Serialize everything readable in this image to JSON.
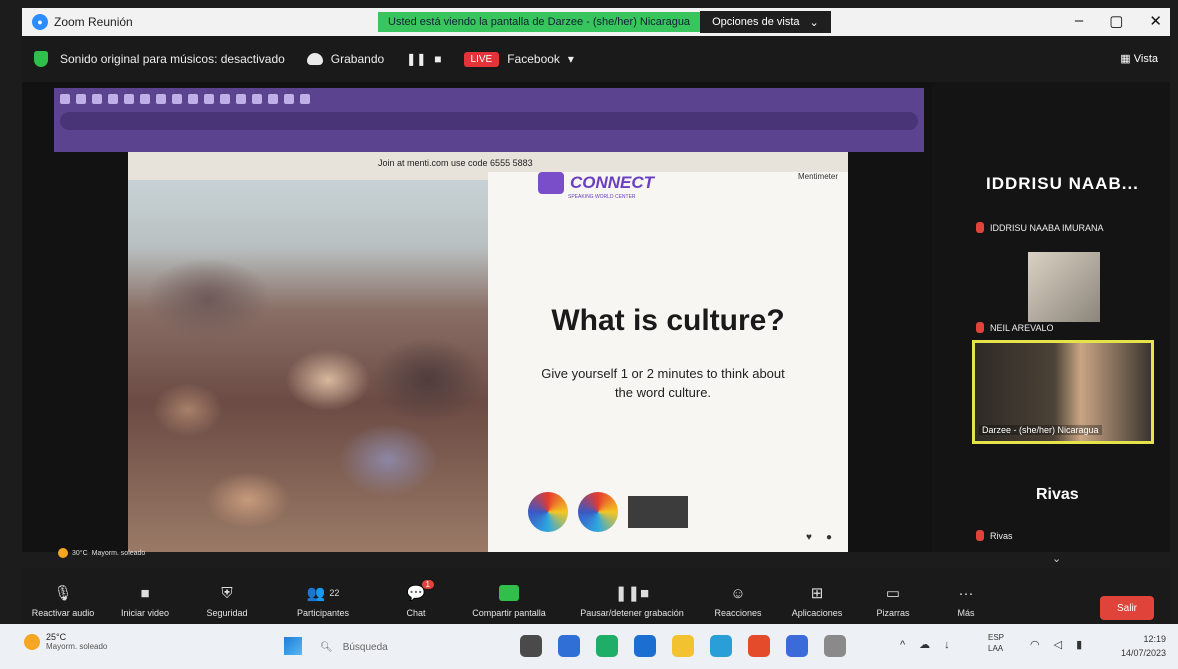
{
  "window": {
    "title": "Zoom Reunión",
    "share_banner": "Usted está viendo la pantalla de Darzee - (she/her) Nicaragua",
    "view_options": "Opciones de vista"
  },
  "meeting_bar": {
    "original_sound": "Sonido original para músicos: desactivado",
    "recording": "Grabando",
    "live": "LIVE",
    "facebook": "Facebook",
    "view": "Vista"
  },
  "slide": {
    "join_text": "Join at menti.com use code 6555 5883",
    "brand": "CONNECT",
    "brand_sub": "SPEAKING WORLD CENTER",
    "mentimeter": "Mentimeter",
    "title": "What is culture?",
    "body": "Give yourself 1 or 2 minutes to think about the word culture."
  },
  "participants": {
    "big_name": "IDDRISU NAAB...",
    "row1": "IDDRISU NAABA IMURANA",
    "row2": "NEIL AREVALO",
    "tile_caption": "Darzee - (she/her) Nicaragua",
    "big_name2": "Rivas",
    "row3": "Rivas"
  },
  "inner_weather": {
    "temp": "30°C",
    "desc": "Mayorm. soleado"
  },
  "toolbar": {
    "unmute": "Reactivar audio",
    "start_video": "Iniciar video",
    "security": "Seguridad",
    "participants": "Participantes",
    "participants_count": "22",
    "chat": "Chat",
    "chat_badge": "1",
    "share": "Compartir pantalla",
    "pause_rec": "Pausar/detener grabación",
    "reactions": "Reacciones",
    "apps": "Aplicaciones",
    "whiteboards": "Pizarras",
    "more": "Más",
    "leave": "Salir"
  },
  "taskbar": {
    "temp": "25°C",
    "weather": "Mayorm. soleado",
    "search": "Búsqueda",
    "lang1": "ESP",
    "lang2": "LAA",
    "time": "12:19",
    "date": "14/07/2023"
  }
}
